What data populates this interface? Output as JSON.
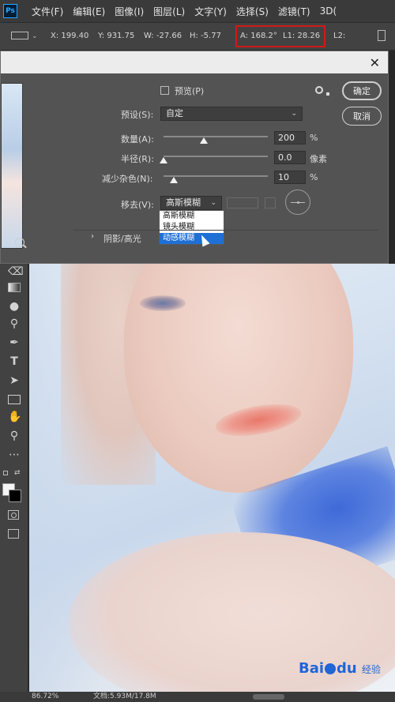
{
  "app": {
    "logo": "Ps"
  },
  "menu": [
    "文件(F)",
    "编辑(E)",
    "图像(I)",
    "图层(L)",
    "文字(Y)",
    "选择(S)",
    "滤镜(T)",
    "3D("
  ],
  "options": {
    "x": "X: 199.40",
    "y": "Y: 931.75",
    "w": "W: -27.66",
    "h": "H: -5.77",
    "a": "A: 168.2°",
    "l1": "L1: 28.26",
    "l2": "L2:"
  },
  "dialog": {
    "preview_label": "预览(P)",
    "preview_checked": false,
    "ok": "确定",
    "cancel": "取消",
    "preset_label": "预设(S):",
    "preset_value": "自定",
    "amount_label": "数量(A):",
    "amount_value": "200",
    "amount_unit": "%",
    "amount_fraction": 0.39,
    "radius_label": "半径(R):",
    "radius_value": "0.0",
    "radius_unit": "像素",
    "radius_fraction": 0.0,
    "noise_label": "减少杂色(N):",
    "noise_value": "10",
    "noise_unit": "%",
    "noise_fraction": 0.1,
    "remove_label": "移去(V):",
    "remove_value": "高斯模糊",
    "remove_options": [
      "高斯模糊",
      "镜头模糊",
      "动感模糊"
    ],
    "remove_highlighted": "动感模糊",
    "section_label": "阴影/高光"
  },
  "status": {
    "zoom": "86.72%",
    "doc": "文档:5.93M/17.8M"
  },
  "watermark": {
    "brand": "Bai",
    "suffix": "du",
    "sub": "经验"
  }
}
